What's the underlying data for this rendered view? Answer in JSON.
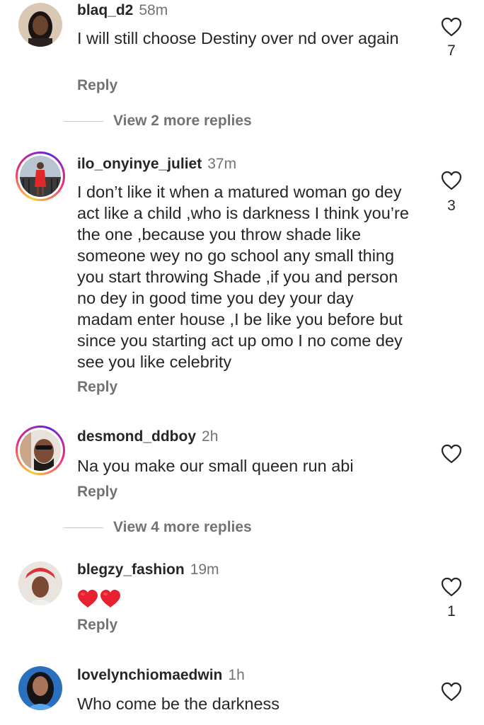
{
  "comments": [
    {
      "username": "blaq_d2",
      "time": "58m",
      "text": "I will still choose Destiny over nd over again",
      "reply_label": "Reply",
      "likes": "7",
      "view_more": "View 2 more replies"
    },
    {
      "username": "ilo_onyinye_juliet",
      "time": "37m",
      "text": "I don’t like it when a matured  woman go dey act like a child ,who is darkness I think you’re the one ,because you throw shade like someone wey no go school any small thing you start throwing Shade ,if you and person no dey in good time you dey your day madam enter house ,I be like you before but since you starting act up omo I no come dey see you like celebrity",
      "reply_label": "Reply",
      "likes": "3"
    },
    {
      "username": "desmond_ddboy",
      "time": "2h",
      "text": "Na you make our small queen run abi",
      "reply_label": "Reply",
      "view_more": "View 4 more replies"
    },
    {
      "username": "blegzy_fashion",
      "time": "19m",
      "reply_label": "Reply",
      "likes": "1"
    },
    {
      "username": "lovelynchiomaedwin",
      "time": "1h",
      "text": "Who come be the darkness"
    }
  ],
  "colors": {
    "text": "#262626",
    "muted": "#737373",
    "divider": "#c7c7c7",
    "emoji_heart": "#e8202f"
  },
  "icons": {
    "like": "heart-outline-icon",
    "emoji": "red-heart-emoji"
  }
}
